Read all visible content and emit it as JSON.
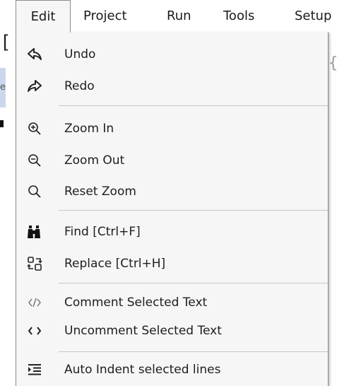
{
  "menubar": {
    "items": [
      {
        "label": "Edit"
      },
      {
        "label": "Project"
      },
      {
        "label": "Run"
      },
      {
        "label": "Tools"
      },
      {
        "label": "Setup"
      }
    ]
  },
  "background": {
    "left_bracket": "[",
    "left_text": "ec",
    "right_text": "{"
  },
  "edit_menu": {
    "items": [
      {
        "label": "Undo",
        "icon": "undo-icon"
      },
      {
        "label": "Redo",
        "icon": "redo-icon"
      },
      {
        "label": "Zoom In",
        "icon": "zoom-in-icon"
      },
      {
        "label": "Zoom Out",
        "icon": "zoom-out-icon"
      },
      {
        "label": "Reset Zoom",
        "icon": "search-icon"
      },
      {
        "label": "Find [Ctrl+F]",
        "icon": "binoculars-icon"
      },
      {
        "label": "Replace [Ctrl+H]",
        "icon": "replace-icon"
      },
      {
        "label": "Comment Selected Text",
        "icon": "comment-code-icon"
      },
      {
        "label": "Uncomment Selected Text",
        "icon": "code-brackets-icon"
      },
      {
        "label": "Auto Indent selected lines",
        "icon": "indent-icon"
      }
    ]
  },
  "colors": {
    "menu_background": "#f6f6f6",
    "border": "#8c8c8c",
    "separator": "#c8c8c8",
    "text": "#1e1e1e"
  }
}
